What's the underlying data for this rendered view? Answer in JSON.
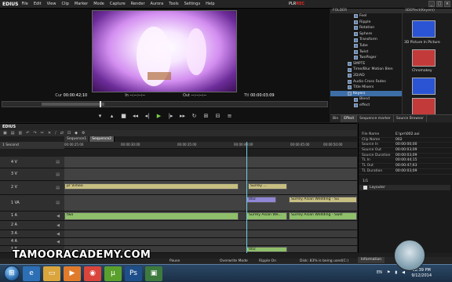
{
  "app": {
    "logo": "EDIUS",
    "menu": [
      "File",
      "Edit",
      "View",
      "Clip",
      "Marker",
      "Mode",
      "Capture",
      "Render",
      "Aurora",
      "Tools",
      "Settings",
      "Help"
    ],
    "mode_prefix": "PLR",
    "mode_suffix": "REC",
    "window_controls": [
      "_",
      "□",
      "×"
    ]
  },
  "player": {
    "cur_label": "Cur",
    "cur_value": "00:00:42;10",
    "in_label": "In",
    "in_value": "--:--:--:--",
    "out_label": "Out",
    "out_value": "--:--:--:--",
    "ttl_label": "Ttl",
    "ttl_value": "00:00:03:09",
    "progress": 0.3,
    "transport_icons": [
      "mark-in-icon",
      "mark-out-icon",
      "stop-icon",
      "rewind-icon",
      "step-back-icon",
      "play-icon",
      "step-forward-icon",
      "fast-forward-icon",
      "loop-icon",
      "insert-icon",
      "overwrite-icon",
      "menu-icon"
    ]
  },
  "folder_panel": {
    "header": "FOLDER",
    "items": [
      "Feel",
      "Ripple",
      "Rotation",
      "Sphere",
      "Transform",
      "Tube",
      "Twist",
      "TwoPager",
      "SMPTE",
      "Time/Blur Motion Blen",
      "2D/AD",
      "Audio Cross Fades",
      "Title Mixers",
      "Keyers",
      "Blend",
      "effect"
    ],
    "selected": "Keyers"
  },
  "effect_panel": {
    "header": "3DEffect(Keyers)",
    "tiles": [
      {
        "label": "3D Picture In Picture",
        "color": "#2a54d4"
      },
      {
        "label": "Chromakey",
        "color": "#c33a3a"
      },
      {
        "label": "",
        "color": "#2a54d4"
      },
      {
        "label": "",
        "color": "#c33a3a"
      }
    ]
  },
  "panel_tabs": [
    "Bin",
    "Effect",
    "Sequence marker",
    "Source Browser"
  ],
  "timeline": {
    "title": "EDIUS",
    "mode_label": "1 Second",
    "sequence_tabs": [
      "Sequence1",
      "Sequence2"
    ],
    "timecode": "00:00:25:00",
    "ruler_ticks": [
      "00:00:25:00",
      "00:00:30:00",
      "00:00:35:00",
      "00:00:40:00",
      "00:00:45:00",
      "00:00:50:00"
    ],
    "tracks": [
      {
        "name": "4 V",
        "type": "v"
      },
      {
        "name": "3 V",
        "type": "v"
      },
      {
        "name": "2 V",
        "type": "va"
      },
      {
        "name": "1 VA",
        "type": "va"
      },
      {
        "name": "1 A",
        "type": "a"
      },
      {
        "name": "2 A",
        "type": "a"
      },
      {
        "name": "3 A",
        "type": "a"
      },
      {
        "name": "4 A",
        "type": "a"
      },
      {
        "name": "1 T",
        "type": "t"
      }
    ],
    "clips": {
      "c1": "pr Vimeo",
      "c2": "Surrey ...",
      "c3": "002",
      "c4": "Surrey Asian Wedding - Su",
      "c5": "two",
      "c6": "Surrey Asian We...",
      "c7": "Surrey Asian Wedding - Swill",
      "c8": "002"
    }
  },
  "status": {
    "pause": "Pause",
    "mode": "Overwrite Mode",
    "ripple": "Ripple On",
    "disk": "Disk: 83% is being used(C:)"
  },
  "info_panel": {
    "rows": [
      {
        "key": "File Name",
        "value": "E:\\prr\\002.avi"
      },
      {
        "key": "Clip Name",
        "value": "002"
      },
      {
        "key": "Source In",
        "value": "00:00:00;00"
      },
      {
        "key": "Source Out",
        "value": "00:00:03;09"
      },
      {
        "key": "Source Duration",
        "value": "00:00:03;09"
      },
      {
        "key": "TL In",
        "value": "00:00:44;15"
      },
      {
        "key": "TL Out",
        "value": "00:00:47;63"
      },
      {
        "key": "TL Duration",
        "value": "00:00:03;09"
      }
    ],
    "layouter_label": "Layouter",
    "layer_count": "1/1",
    "tabs": [
      "Information"
    ]
  },
  "watermark": "TAMOORACADEMY.COM",
  "taskbar": {
    "lang": "EN",
    "time": "12:39 PM",
    "date": "9/12/2014",
    "apps": [
      {
        "icon": "ie-icon",
        "color": "#2d6fb5"
      },
      {
        "icon": "folder-icon",
        "color": "#d9a53c"
      },
      {
        "icon": "media-icon",
        "color": "#e07b2b"
      },
      {
        "icon": "chrome-icon",
        "color": "#d9453b"
      },
      {
        "icon": "torrent-icon",
        "color": "#5aa02c"
      },
      {
        "icon": "photoshop-icon",
        "color": "#1f4f8a"
      },
      {
        "icon": "edius-icon",
        "color": "#3d7a3d"
      }
    ]
  }
}
